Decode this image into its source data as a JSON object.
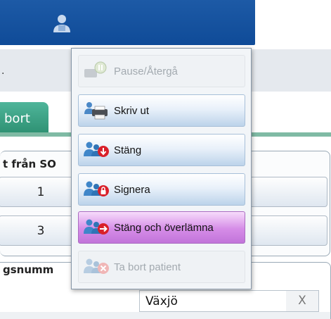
{
  "header": {
    "user_icon": "user-icon"
  },
  "background": {
    "tab_label": "bort",
    "group_title": "t från SO",
    "cells": [
      "1",
      "3"
    ],
    "group2_title": "gsnumm",
    "city_value": "Växjö",
    "clear_label": "X"
  },
  "menu": {
    "items": [
      {
        "label": "Pause/Återgå",
        "icon": "pause-resume-icon",
        "state": "disabled"
      },
      {
        "label": "Skriv ut",
        "icon": "print-icon",
        "state": "normal"
      },
      {
        "label": "Stäng",
        "icon": "close-patient-icon",
        "state": "normal"
      },
      {
        "label": "Signera",
        "icon": "sign-lock-icon",
        "state": "normal"
      },
      {
        "label": "Stäng och överlämna",
        "icon": "close-handover-icon",
        "state": "selected"
      },
      {
        "label": "Ta bort patient",
        "icon": "remove-patient-icon",
        "state": "disabled"
      }
    ]
  },
  "colors": {
    "header_blue": "#1d5aa6",
    "tab_green": "#3fa586",
    "selected_purple": "#c274da",
    "menu_blue": "#bcd3ea"
  }
}
